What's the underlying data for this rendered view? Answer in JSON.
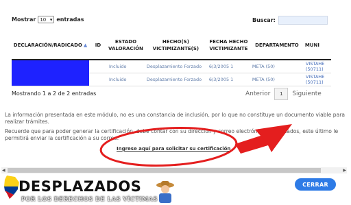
{
  "controls": {
    "show_label": "Mostrar",
    "page_size": "10",
    "entries_label": "entradas",
    "search_label": "Buscar:",
    "search_value": ""
  },
  "table": {
    "headers": [
      "DECLARACIÓN/RADICADO",
      "ID",
      "ESTADO VALORACIÓN",
      "HECHO(S) VICTIMIZANTE(S)",
      "FECHA HECHO VICTIMIZANTE",
      "DEPARTAMENTO",
      "MUNI"
    ],
    "rows": [
      {
        "estado": "Incluido",
        "hecho": "Desplazamiento Forzado",
        "fecha": "6/3/2005 1",
        "departamento": "META (50)",
        "municipio": "VISTAHE (50711)"
      },
      {
        "estado": "Incluido",
        "hecho": "Desplazamiento Forzado",
        "fecha": "6/3/2005 1",
        "departamento": "META (50)",
        "municipio": "VISTAHE (50711)"
      }
    ]
  },
  "footer": {
    "showing": "Mostrando 1 a 2 de 2 entradas",
    "prev": "Anterior",
    "page": "1",
    "next": "Siguiente"
  },
  "info": {
    "paragraph1": "La información presentada en este módulo, no es una constancia de inclusión, por lo que no constituye un documento viable para realizar trámites.",
    "paragraph2": "Recuerde que para poder generar la certificación, debe contar con su dirección y correo electrónico actualizados, este último le permitirá enviar la certificación a su correo.",
    "request_link": "Ingrese aquí para solicitar su certificación"
  },
  "close_button": "CERRAR",
  "branding": {
    "logo": "DESPLAZADOS",
    "tagline": "POR LOS DERECHOS DE LAS VÍCTIMAS"
  },
  "colors": {
    "redacted_block": "#1e22ff",
    "annotation": "#e41e1e",
    "button": "#2e7be6"
  }
}
